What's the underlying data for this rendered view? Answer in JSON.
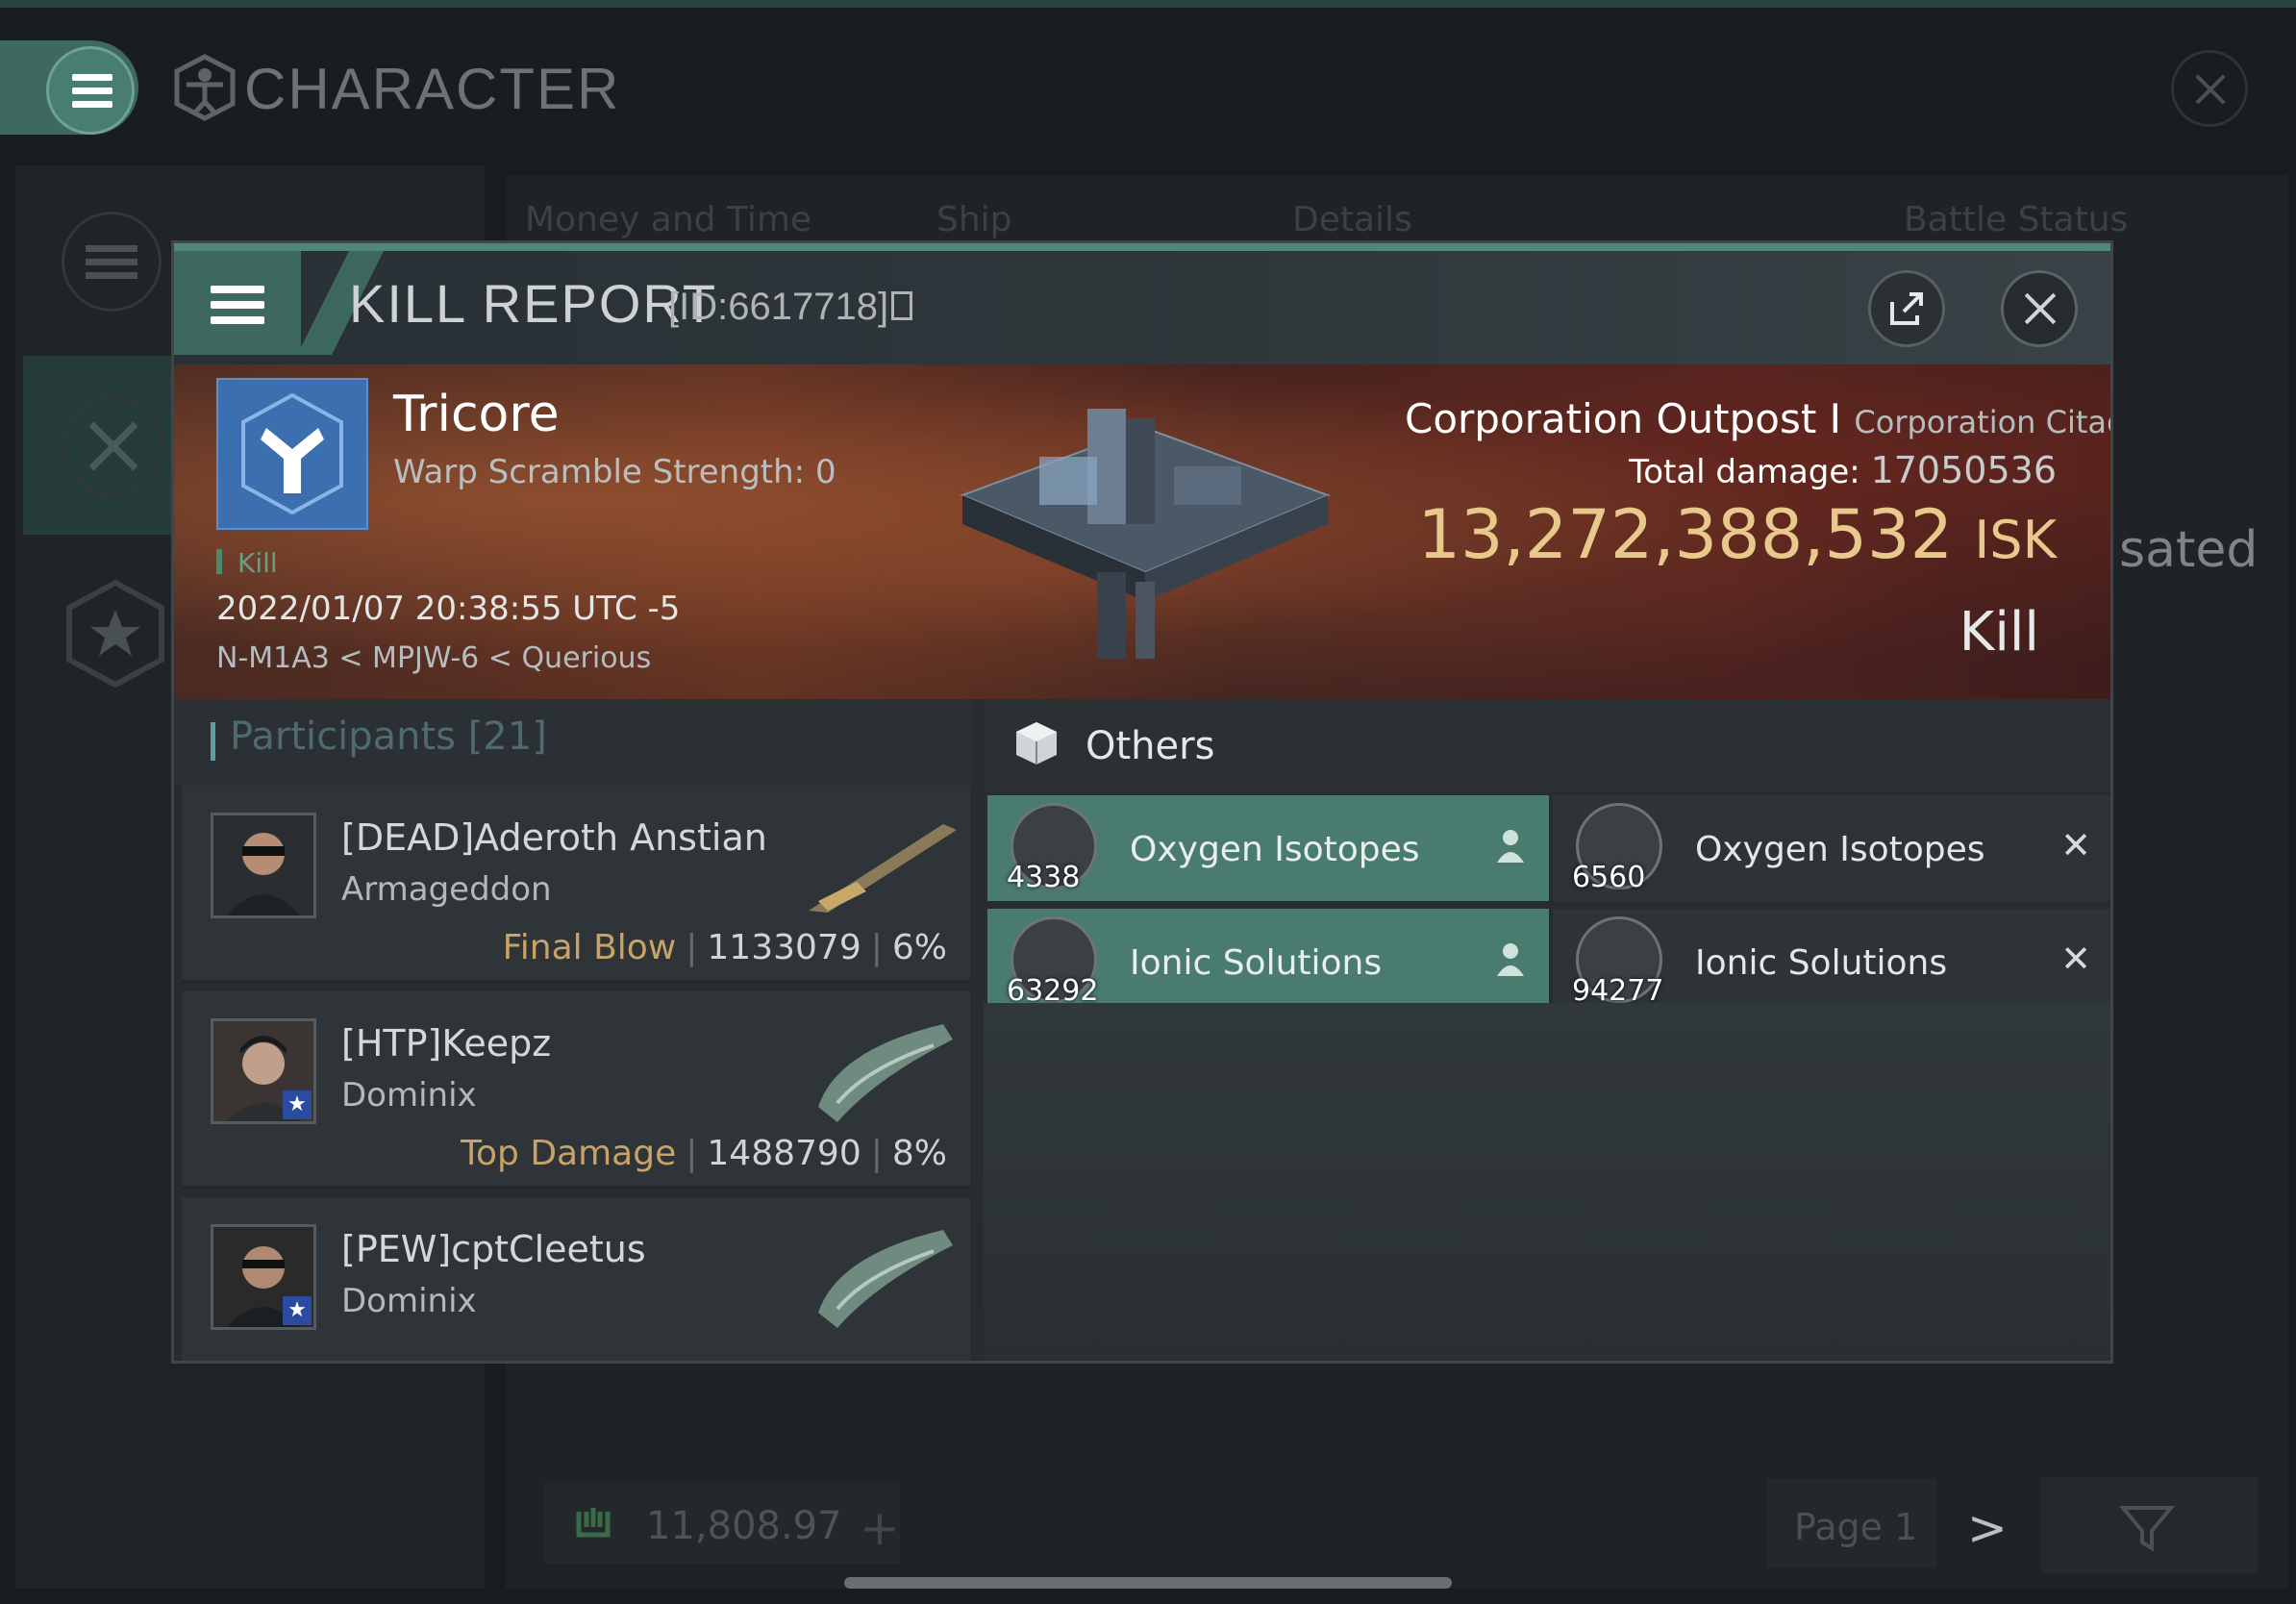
{
  "background": {
    "title": "CHARACTER",
    "tabs": [
      "Money and Time",
      "Ship",
      "Details",
      "Battle Status"
    ],
    "partial_text": "sated",
    "wallet_amount": "11,808.97",
    "page_label": "Page 1"
  },
  "report": {
    "title": "KILL REPORT",
    "id_label": "[ID:6617718]",
    "victim": {
      "corp_name": "Tricore",
      "warp_scramble": "Warp Scramble Strength: 0",
      "tag": "Kill",
      "date": "2022/01/07 20:38:55 UTC -5",
      "location": "N-M1A3 < MPJW-6 < Querious"
    },
    "structure": {
      "name": "Corporation Outpost I",
      "type": "Corporation Citadel",
      "total_damage_label": "Total damage:",
      "total_damage_value": "17050536",
      "isk_value": "13,272,388,532",
      "isk_unit": "ISK",
      "result": "Kill"
    },
    "participants": {
      "title": "Participants",
      "count": "[21]",
      "items": [
        {
          "name": "[DEAD]Aderoth Anstian",
          "ship": "Armageddon",
          "tag": "Final Blow",
          "damage": "1133079",
          "percent": "6%"
        },
        {
          "name": "[HTP]Keepz",
          "ship": "Dominix",
          "tag": "Top Damage",
          "damage": "1488790",
          "percent": "8%"
        },
        {
          "name": "[PEW]cptCleetus",
          "ship": "Dominix",
          "tag": "",
          "damage": "",
          "percent": ""
        }
      ]
    },
    "others": {
      "title": "Others",
      "items": [
        {
          "qty": "4338",
          "name": "Oxygen Isotopes",
          "state": "dropped"
        },
        {
          "qty": "6560",
          "name": "Oxygen Isotopes",
          "state": "destroyed"
        },
        {
          "qty": "63292",
          "name": "Ionic Solutions",
          "state": "dropped"
        },
        {
          "qty": "94277",
          "name": "Ionic Solutions",
          "state": "destroyed"
        }
      ]
    }
  },
  "colors": {
    "accent": "#4a7b6f",
    "isk": "#e8c98c",
    "tag": "#c9a265"
  },
  "icons": [
    "menu-icon",
    "character-icon",
    "close-icon",
    "export-icon",
    "copy-icon",
    "box-icon",
    "person-icon",
    "x-icon",
    "wallet-icon",
    "plus-icon",
    "chevron-right-icon",
    "filter-icon",
    "star-icon"
  ]
}
